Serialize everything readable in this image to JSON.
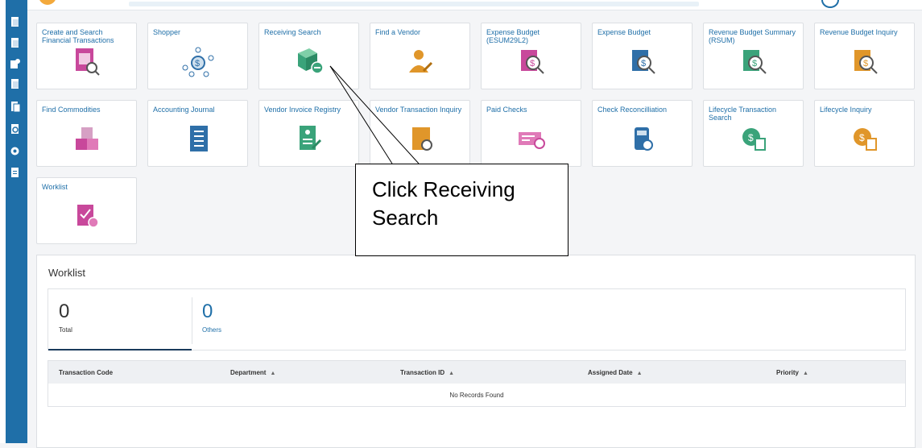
{
  "sidebar": {
    "icons": [
      "document-icon",
      "document-icon",
      "transactions-icon",
      "document-icon",
      "documents-icon",
      "search-doc-icon",
      "settings-gear-icon",
      "report-icon"
    ]
  },
  "tiles": [
    {
      "label": "Create and Search Financial Transactions",
      "icon": "financial-search-icon",
      "color": "#c8489b"
    },
    {
      "label": "Shopper",
      "icon": "network-dollar-icon",
      "color": "#2f6fa8"
    },
    {
      "label": "Receiving Search",
      "icon": "package-receiving-icon",
      "color": "#3aa37a"
    },
    {
      "label": "Find a Vendor",
      "icon": "vendor-person-icon",
      "color": "#e0962a"
    },
    {
      "label": "Expense Budget (ESUM29L2)",
      "icon": "budget-search-icon",
      "color": "#c8489b"
    },
    {
      "label": "Expense Budget",
      "icon": "budget-search-icon",
      "color": "#2f6fa8"
    },
    {
      "label": "Revenue Budget Summary (RSUM)",
      "icon": "budget-search-icon",
      "color": "#3aa37a"
    },
    {
      "label": "Revenue Budget Inquiry",
      "icon": "budget-search-icon",
      "color": "#e0962a"
    },
    {
      "label": "Find Commodities",
      "icon": "commodities-boxes-icon",
      "color": "#c8489b"
    },
    {
      "label": "Accounting Journal",
      "icon": "journal-list-icon",
      "color": "#2f6fa8"
    },
    {
      "label": "Vendor Invoice Registry",
      "icon": "invoice-registry-icon",
      "color": "#3aa37a"
    },
    {
      "label": "Vendor Transaction Inquiry",
      "icon": "vendor-transaction-icon",
      "color": "#e0962a"
    },
    {
      "label": "Paid Checks",
      "icon": "paid-checks-icon",
      "color": "#c8489b"
    },
    {
      "label": "Check Reconcilliation",
      "icon": "check-reconcile-icon",
      "color": "#2f6fa8"
    },
    {
      "label": "Lifecycle Transaction Search",
      "icon": "lifecycle-search-icon",
      "color": "#3aa37a"
    },
    {
      "label": "Lifecycle Inquiry",
      "icon": "lifecycle-inquiry-icon",
      "color": "#e0962a"
    },
    {
      "label": "Worklist",
      "icon": "worklist-gear-icon",
      "color": "#c8489b"
    }
  ],
  "worklist": {
    "title": "Worklist",
    "total_count": "0",
    "total_label": "Total",
    "others_count": "0",
    "others_label": "Others",
    "columns": [
      "Transaction Code",
      "Department",
      "Transaction ID",
      "Assigned Date",
      "Priority"
    ],
    "empty_message": "No Records Found"
  },
  "callout": {
    "line1": "Click Receiving",
    "line2": "Search"
  },
  "colors": {
    "accent": "#1f6fa8",
    "count_blue": "#1f6fa8"
  }
}
